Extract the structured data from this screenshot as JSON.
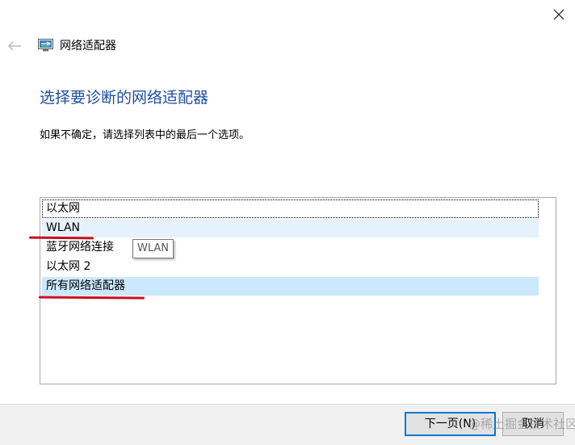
{
  "window": {
    "title": "网络适配器",
    "close_icon": "close-icon",
    "back_icon": "back-arrow-icon",
    "app_icon": "network-adapter-icon"
  },
  "main": {
    "heading": "选择要诊断的网络适配器",
    "instruction": "如果不确定，请选择列表中的最后一个选项。"
  },
  "list": {
    "items": [
      {
        "label": "以太网",
        "state": "focused"
      },
      {
        "label": "WLAN",
        "state": "hover"
      },
      {
        "label": "蓝牙网络连接",
        "state": "normal"
      },
      {
        "label": "以太网 2",
        "state": "normal"
      },
      {
        "label": "所有网络适配器",
        "state": "selected"
      }
    ],
    "tooltip": "WLAN"
  },
  "footer": {
    "next_label": "下一页(N)",
    "cancel_label": "取消"
  },
  "watermark": "@稀土掘金技术社区",
  "colors": {
    "heading": "#1f4e9e",
    "selected": "#cce8ff",
    "hover": "#e5f1fb",
    "annotation": "#c8101c",
    "default_button_border": "#0078d7"
  }
}
